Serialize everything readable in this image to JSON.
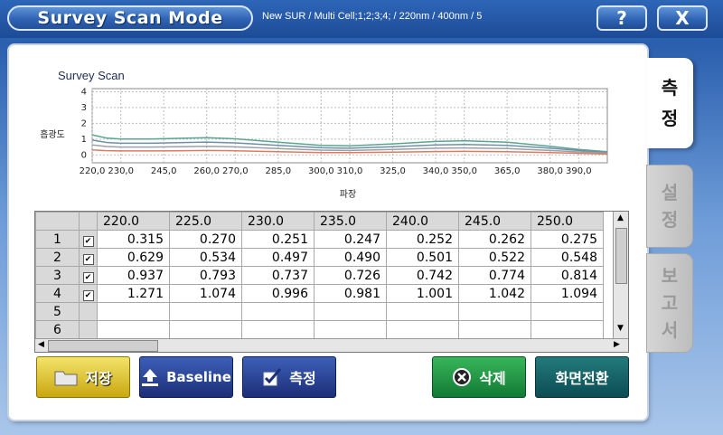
{
  "window": {
    "title": "Survey Scan Mode",
    "subtitle": "New SUR / Multi Cell;1;2;3;4; / 220nm / 400nm / 5",
    "help_label": "?",
    "close_label": "X"
  },
  "tabs": [
    {
      "label": "측\n정"
    },
    {
      "label": "설\n정"
    },
    {
      "label": "보\n고\n서"
    }
  ],
  "chart_data": {
    "type": "line",
    "title": "Survey Scan",
    "xlabel": "파장",
    "ylabel": "흡광도",
    "xlim": [
      220,
      400
    ],
    "ylim": [
      -0.5,
      4.2
    ],
    "xticks": [
      "220,0",
      "230,0",
      "245,0",
      "260,0",
      "270,0",
      "285,0",
      "300,0",
      "310,0",
      "325,0",
      "340,0",
      "350,0",
      "365,0",
      "380,0",
      "390,0"
    ],
    "xtick_values": [
      220,
      230,
      245,
      260,
      270,
      285,
      300,
      310,
      325,
      340,
      350,
      365,
      380,
      390
    ],
    "yticks": [
      "4",
      "3",
      "2",
      "1",
      "0"
    ],
    "series": [
      {
        "color": "#5aa58e",
        "x": [
          220,
          225,
          230,
          240,
          250,
          260,
          270,
          285,
          300,
          310,
          325,
          340,
          350,
          365,
          380,
          390,
          400
        ],
        "values": [
          1.27,
          1.07,
          1.0,
          1.0,
          1.05,
          1.09,
          1.02,
          0.8,
          0.6,
          0.58,
          0.7,
          0.85,
          0.9,
          0.8,
          0.55,
          0.35,
          0.2
        ]
      },
      {
        "color": "#6f8fa8",
        "x": [
          220,
          225,
          230,
          240,
          250,
          260,
          270,
          285,
          300,
          310,
          325,
          340,
          350,
          365,
          380,
          390,
          400
        ],
        "values": [
          0.94,
          0.79,
          0.74,
          0.74,
          0.77,
          0.81,
          0.76,
          0.6,
          0.45,
          0.42,
          0.52,
          0.63,
          0.66,
          0.6,
          0.42,
          0.28,
          0.15
        ]
      },
      {
        "color": "#9aa0a8",
        "x": [
          220,
          225,
          230,
          240,
          250,
          260,
          270,
          285,
          300,
          310,
          325,
          340,
          350,
          365,
          380,
          390,
          400
        ],
        "values": [
          0.63,
          0.53,
          0.5,
          0.5,
          0.52,
          0.55,
          0.51,
          0.4,
          0.3,
          0.28,
          0.35,
          0.42,
          0.44,
          0.4,
          0.28,
          0.19,
          0.1
        ]
      },
      {
        "color": "#e07a5f",
        "x": [
          220,
          225,
          230,
          240,
          250,
          260,
          270,
          285,
          300,
          310,
          325,
          340,
          350,
          365,
          380,
          390,
          400
        ],
        "values": [
          0.32,
          0.27,
          0.25,
          0.25,
          0.26,
          0.28,
          0.26,
          0.2,
          0.15,
          0.14,
          0.17,
          0.21,
          0.22,
          0.2,
          0.14,
          0.1,
          0.05
        ]
      }
    ]
  },
  "table": {
    "columns": [
      "220.0",
      "225.0",
      "230.0",
      "235.0",
      "240.0",
      "245.0",
      "250.0"
    ],
    "rows": [
      {
        "index": "1",
        "checked": "✔",
        "values": [
          "0.315",
          "0.270",
          "0.251",
          "0.247",
          "0.252",
          "0.262",
          "0.275"
        ]
      },
      {
        "index": "2",
        "checked": "✔",
        "values": [
          "0.629",
          "0.534",
          "0.497",
          "0.490",
          "0.501",
          "0.522",
          "0.548"
        ]
      },
      {
        "index": "3",
        "checked": "✔",
        "values": [
          "0.937",
          "0.793",
          "0.737",
          "0.726",
          "0.742",
          "0.774",
          "0.814"
        ]
      },
      {
        "index": "4",
        "checked": "✔",
        "values": [
          "1.271",
          "1.074",
          "0.996",
          "0.981",
          "1.001",
          "1.042",
          "1.094"
        ]
      },
      {
        "index": "5",
        "checked": "",
        "values": [
          "",
          "",
          "",
          "",
          "",
          "",
          ""
        ]
      },
      {
        "index": "6",
        "checked": "",
        "values": [
          "",
          "",
          "",
          "",
          "",
          "",
          ""
        ]
      }
    ]
  },
  "buttons": {
    "save": "저장",
    "baseline": "Baseline",
    "measure": "측정",
    "delete": "삭제",
    "screen_switch": "화면전환"
  }
}
